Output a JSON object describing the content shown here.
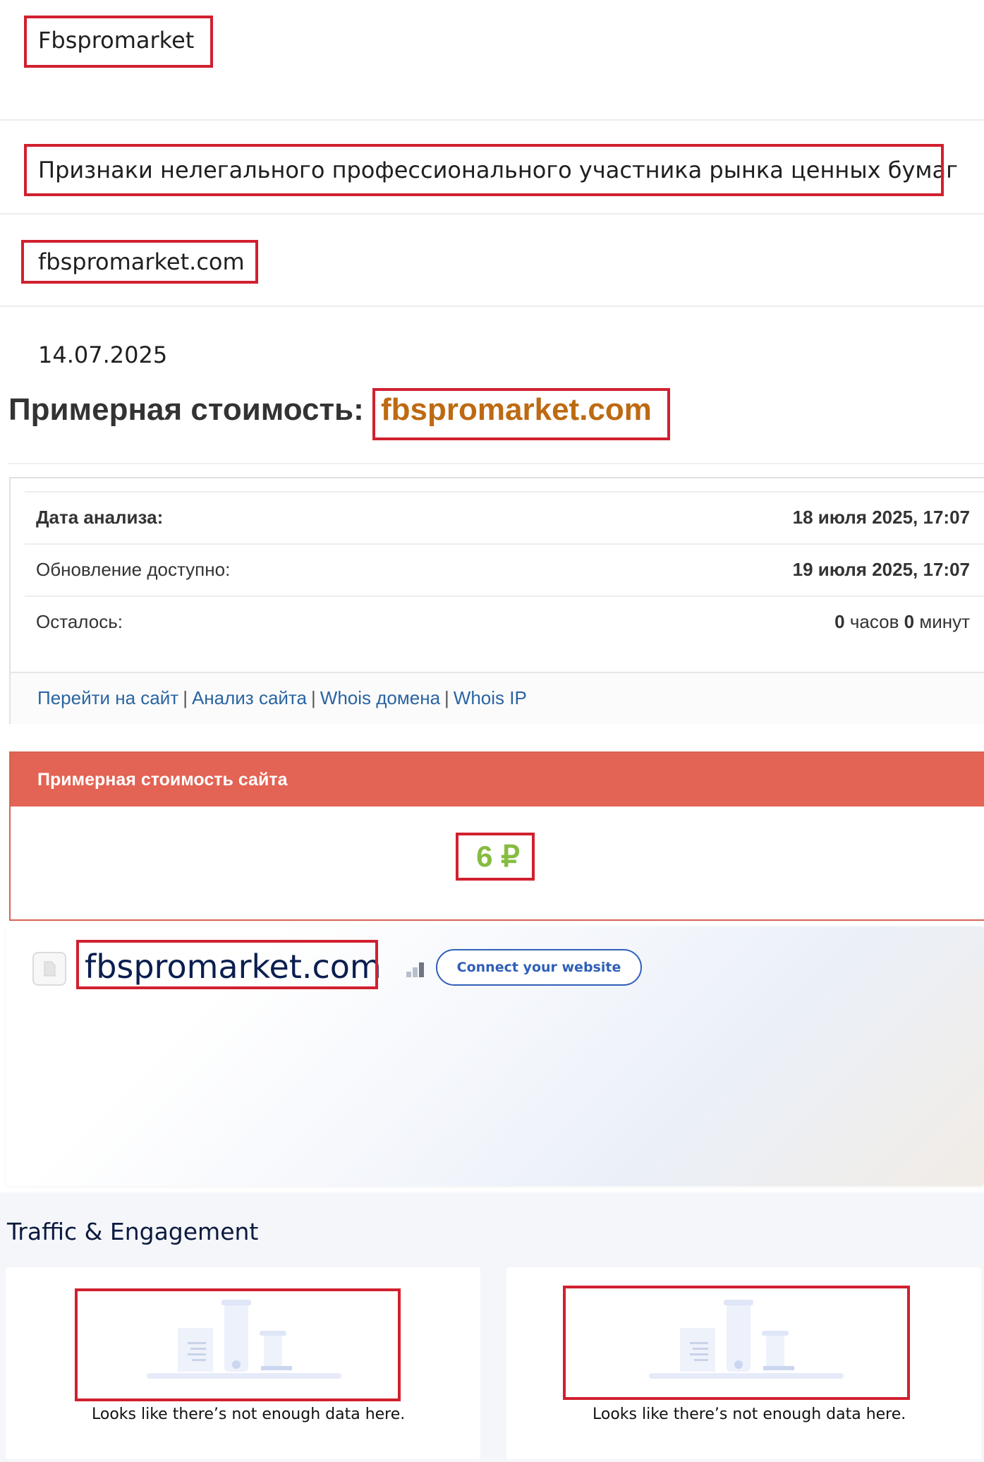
{
  "rows": {
    "name": "Fbspromarket",
    "category": "Признаки нелегального профессионального участника рынка ценных бумаг",
    "domain": "fbspromarket.com",
    "date": "14.07.2025"
  },
  "heading": {
    "prefix": "Примерная стоимость:",
    "domain": "fbspromarket.com"
  },
  "analysis": {
    "date_label": "Дата анализа:",
    "date_value": "18 июля 2025, 17:07",
    "update_label": "Обновление доступно:",
    "update_value": "19 июля 2025, 17:07",
    "left_label": "Осталось:",
    "left_hours": "0",
    "left_hours_unit": "часов",
    "left_minutes": "0",
    "left_minutes_unit": "минут",
    "links": [
      "Перейти на сайт",
      "Анализ сайта",
      "Whois домена",
      "Whois IP"
    ],
    "link_separator": "|"
  },
  "price": {
    "title": "Примерная стоимость сайта",
    "value": "6 ₽"
  },
  "site_card": {
    "domain": "fbspromarket.com",
    "connect_label": "Connect your website"
  },
  "traffic": {
    "title": "Traffic & Engagement",
    "empty_left": "Looks like there’s not enough data here.",
    "empty_right": "Looks like there’s not enough data here."
  },
  "colors": {
    "highlight": "#d1202f",
    "domain_orange": "#bd6a12",
    "price_header": "#e36354",
    "price_value": "#86bc41",
    "link_blue": "#2a64a3",
    "navy": "#0a1e4f",
    "connect_blue": "#2f5fb8"
  }
}
